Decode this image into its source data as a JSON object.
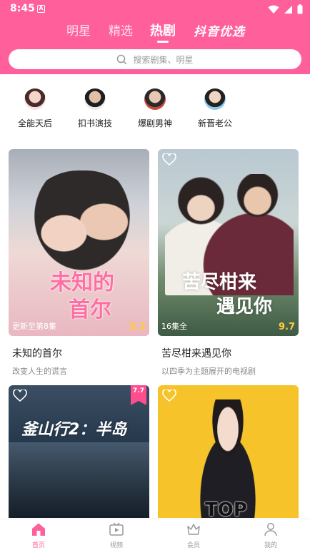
{
  "status": {
    "time": "8:45",
    "notif_letter": "A"
  },
  "tabs": [
    {
      "label": "明星"
    },
    {
      "label": "精选"
    },
    {
      "label": "热剧"
    }
  ],
  "brand_label": "抖音优选",
  "search": {
    "placeholder": "搜索剧集、明星"
  },
  "categories": [
    {
      "label": "全能天后"
    },
    {
      "label": "扣书演技"
    },
    {
      "label": "爆剧男神"
    },
    {
      "label": "新晋老公"
    }
  ],
  "cards": [
    {
      "poster_title_1": "未知的",
      "poster_title_2": "首尔",
      "episode": "更新至第8集",
      "score": "9.2",
      "title": "未知的首尔",
      "desc": "改变人生的谎言"
    },
    {
      "poster_title_1": "苦尽柑来",
      "poster_title_2": "遇见你",
      "episode": "16集全",
      "score": "9.7",
      "title": "苦尽柑来遇见你",
      "desc": "以四季为主题展开的电视剧"
    },
    {
      "poster_title_1": "釜山行2：半岛",
      "badge": "7.7"
    },
    {
      "poster_title_1": "TOP"
    }
  ],
  "bottom_nav": [
    {
      "label": "首页",
      "icon": "home-icon"
    },
    {
      "label": "视频",
      "icon": "video-icon"
    },
    {
      "label": "会员",
      "icon": "crown-icon"
    },
    {
      "label": "我的",
      "icon": "profile-icon"
    }
  ],
  "colors": {
    "accent": "#ff5f9b",
    "score": "#ffcd3a"
  }
}
